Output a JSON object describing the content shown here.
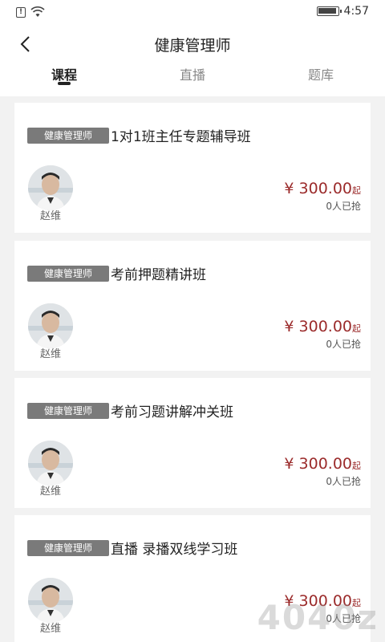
{
  "status_bar": {
    "time": "4:57"
  },
  "header": {
    "title": "健康管理师"
  },
  "tabs": [
    {
      "label": "课程",
      "active": true
    },
    {
      "label": "直播",
      "active": false
    },
    {
      "label": "题库",
      "active": false
    }
  ],
  "courses": [
    {
      "tag": "健康管理师",
      "title": "1对1班主任专题辅导班",
      "teacher": "赵维",
      "price": "¥ 300.00",
      "price_suffix": "起",
      "enrolled": "0人已抢"
    },
    {
      "tag": "健康管理师",
      "title": "考前押题精讲班",
      "teacher": "赵维",
      "price": "¥ 300.00",
      "price_suffix": "起",
      "enrolled": "0人已抢"
    },
    {
      "tag": "健康管理师",
      "title": "考前习题讲解冲关班",
      "teacher": "赵维",
      "price": "¥ 300.00",
      "price_suffix": "起",
      "enrolled": "0人已抢"
    },
    {
      "tag": "健康管理师",
      "title": "直播 录播双线学习班",
      "teacher": "赵维",
      "price": "¥ 300.00",
      "price_suffix": "起",
      "enrolled": "0人已抢"
    }
  ],
  "watermark": {
    "text": "4040z"
  },
  "colors": {
    "price": "#9b2b2b",
    "tag_bg": "#7a7a7a",
    "page_bg": "#f2f2f2"
  }
}
